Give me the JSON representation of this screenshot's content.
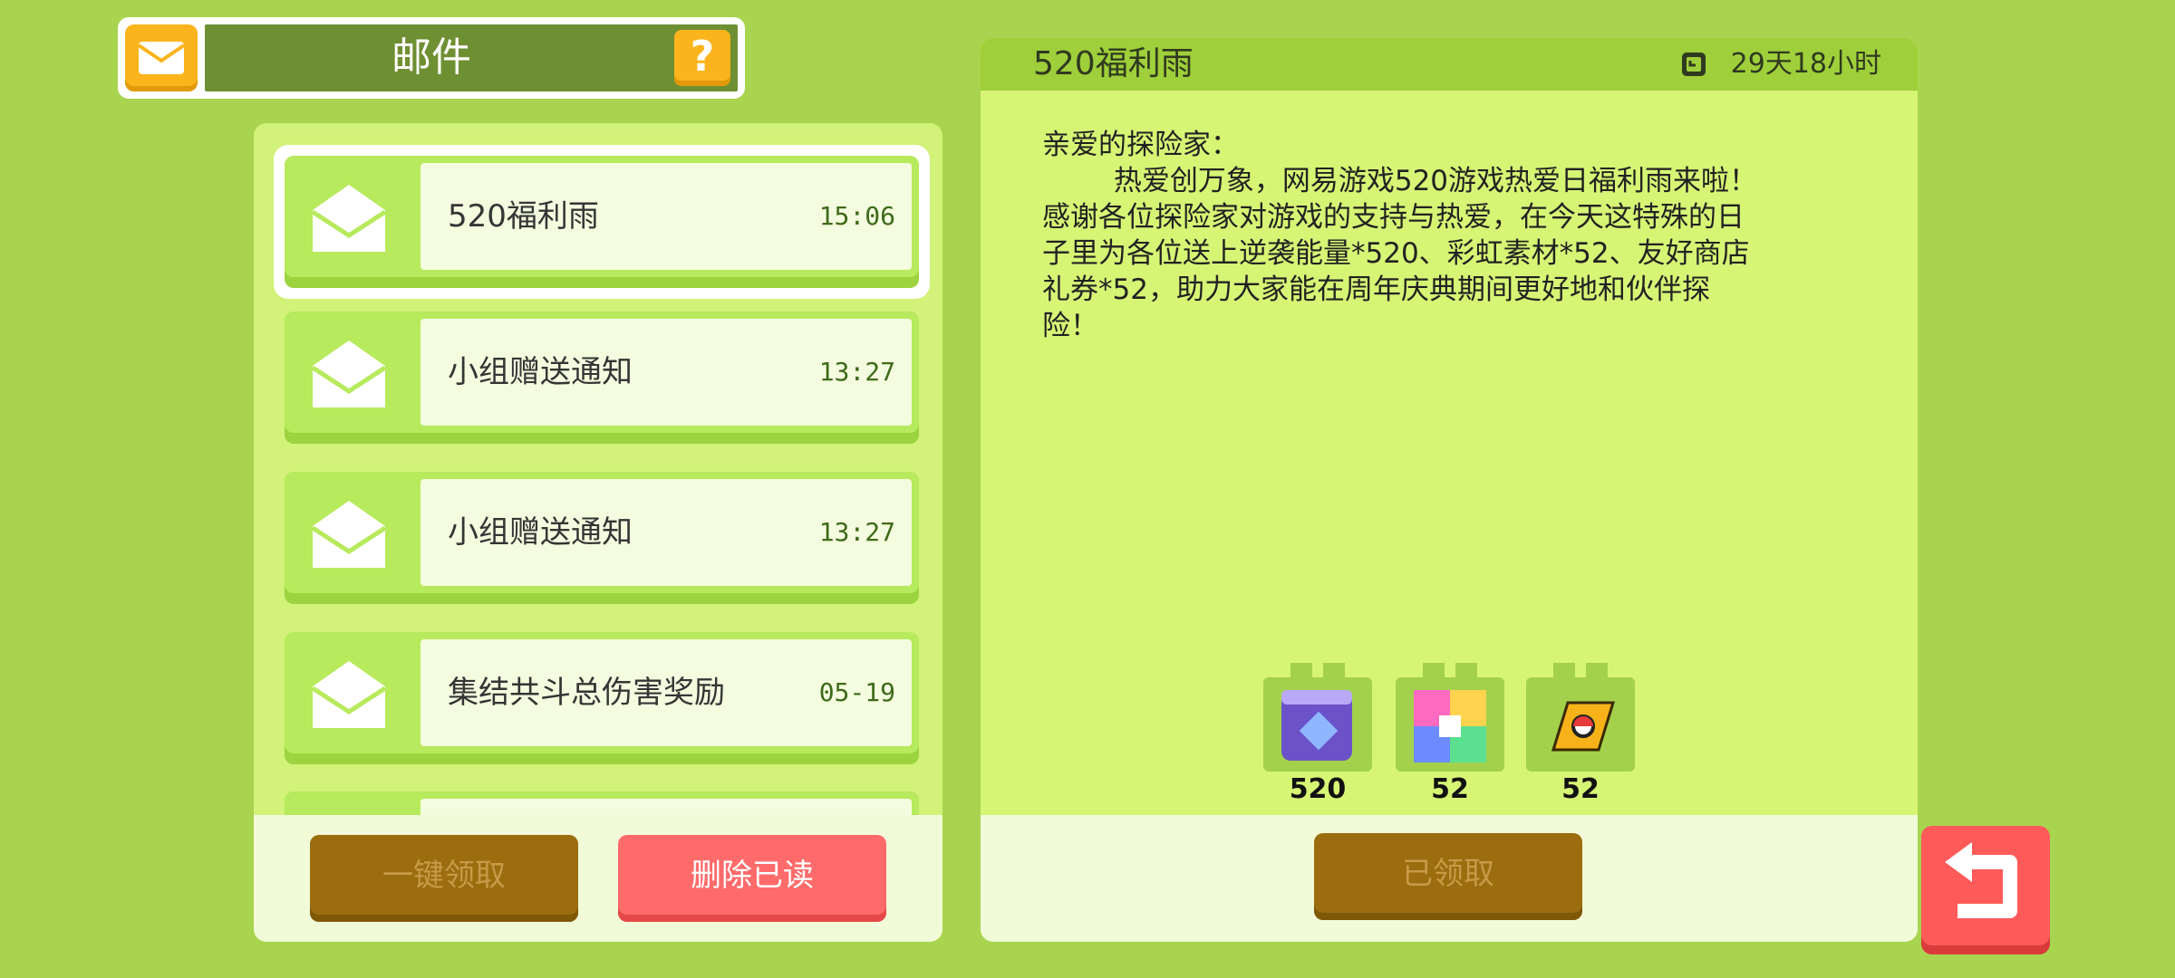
{
  "header": {
    "title": "邮件",
    "help_icon": "?"
  },
  "mail_list": [
    {
      "subject": "520福利雨",
      "time": "15:06",
      "selected": true
    },
    {
      "subject": "小组赠送通知",
      "time": "13:27"
    },
    {
      "subject": "小组赠送通知",
      "time": "13:27"
    },
    {
      "subject": "集结共斗总伤害奖励",
      "time": "05-19"
    }
  ],
  "buttons": {
    "claim_all": "一键领取",
    "delete_read": "删除已读",
    "claimed": "已领取"
  },
  "detail": {
    "title": "520福利雨",
    "remaining": "29天18小时",
    "body": "亲爱的探险家：\n        热爱创万象，网易游戏520游戏热爱日福利雨来啦！\n感谢各位探险家对游戏的支持与热爱，在今天这特殊的日\n子里为各位送上逆袭能量*520、彩虹素材*52、友好商店\n礼券*52，助力大家能在周年庆典期间更好地和伙伴探\n险！",
    "rewards": [
      {
        "icon": "purple-cube-icon",
        "count": "520"
      },
      {
        "icon": "rainbow-material-icon",
        "count": "52"
      },
      {
        "icon": "shop-ticket-icon",
        "count": "52"
      }
    ]
  },
  "colors": {
    "background": "#a9d44f",
    "accent_orange": "#fbb41b",
    "red_button": "#ff6b6b",
    "disabled_brown": "#9b6d0f"
  }
}
